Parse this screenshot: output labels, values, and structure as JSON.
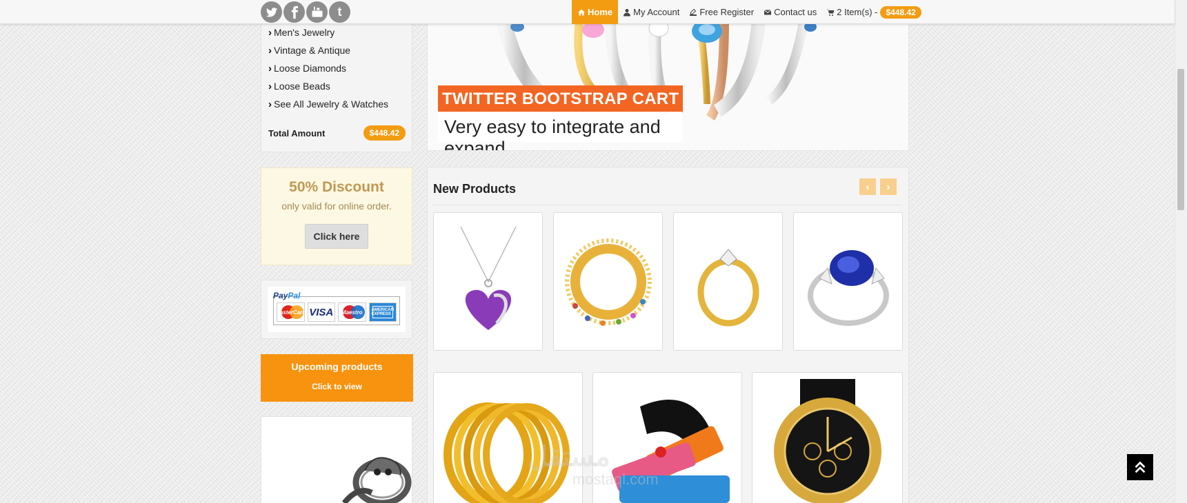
{
  "header": {
    "social": [
      {
        "icon": "twitter-icon"
      },
      {
        "icon": "facebook-icon"
      },
      {
        "icon": "youtube-icon",
        "text": "You Tube"
      },
      {
        "icon": "tumblr-icon",
        "text": "t"
      }
    ],
    "nav": {
      "home": "Home",
      "account": "My Account",
      "register": "Free Register",
      "contact": "Contact us",
      "cart": "2 Item(s) -",
      "cart_total": "$448.42"
    }
  },
  "sidebar": {
    "categories": [
      "Men's Jewelry",
      "Vintage & Antique",
      "Loose Diamonds",
      "Loose Beads",
      "See All Jewelry & Watches"
    ],
    "total_label": "Total Amount",
    "total_value": "$448.42",
    "discount": {
      "title": "50% Discount",
      "subtitle": "only valid for online order.",
      "button": "Click here"
    },
    "payment": {
      "paypal_a": "Pay",
      "paypal_b": "Pal",
      "cards": [
        "MasterCard",
        "VISA",
        "Maestro",
        "AMERICAN EXPRESS"
      ]
    },
    "upcoming": {
      "title": "Upcoming products",
      "link": "Click to view"
    }
  },
  "hero": {
    "title": "TWITTER BOOTSTRAP CART",
    "subtitle": "Very easy to integrate and expand."
  },
  "products": {
    "title": "New Products",
    "prev": "‹",
    "next": "›"
  },
  "watermark": {
    "text": "مستقل",
    "sub": "mostaql.com"
  },
  "colors": {
    "accent": "#f39c12",
    "hero_caption": "#f26522",
    "discount_bg": "#fcf8e3",
    "upcoming_bg": "#f7930f"
  }
}
